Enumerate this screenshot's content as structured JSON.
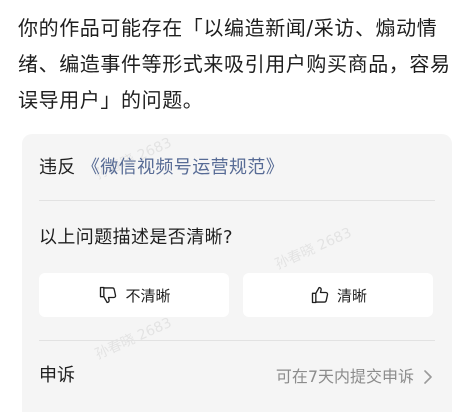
{
  "message": {
    "text": "你的作品可能存在「以编造新闻/采访、煽动情绪、编造事件等形式来吸引用户购买商品，容易误导用户」的问题。"
  },
  "card": {
    "violation_prefix": "违反",
    "violation_link": "《微信视频号运营规范》",
    "question": "以上问题描述是否清晰?",
    "buttons": {
      "unclear_label": "不清晰",
      "clear_label": "清晰"
    },
    "appeal": {
      "label": "申诉",
      "hint": "可在7天内提交申诉"
    },
    "watermark": "孙春晓 2683"
  },
  "colors": {
    "link": "#576b95",
    "card_background": "#f5f5f5",
    "hint": "#8c8c8c"
  },
  "icons": {
    "unclear": "thumbs-down-icon",
    "clear": "thumbs-up-icon",
    "appeal": "chevron-right-icon"
  }
}
